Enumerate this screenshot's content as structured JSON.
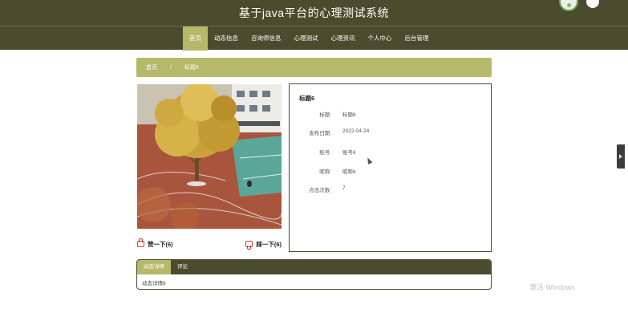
{
  "header": {
    "title": "基于java平台的心理测试系统"
  },
  "nav": {
    "items": [
      {
        "label": "首页",
        "active": true
      },
      {
        "label": "动态信息",
        "active": false
      },
      {
        "label": "咨询师信息",
        "active": false
      },
      {
        "label": "心理测试",
        "active": false
      },
      {
        "label": "心理资讯",
        "active": false
      },
      {
        "label": "个人中心",
        "active": false
      },
      {
        "label": "后台管理",
        "active": false
      }
    ]
  },
  "breadcrumb": {
    "home": "首页",
    "separator": "/",
    "current": "标题6"
  },
  "votes": {
    "like_label": "赞一下(6)",
    "dislike_label": "踩一下(6)"
  },
  "detail": {
    "title": "标题6",
    "rows": [
      {
        "label": "标题:",
        "value": "标题6"
      },
      {
        "label": "发布日期:",
        "value": "2022-04-24"
      },
      {
        "label": "账号:",
        "value": "账号6"
      },
      {
        "label": "昵称:",
        "value": "昵称6"
      },
      {
        "label": "点击次数:",
        "value": "7"
      }
    ]
  },
  "tabs": {
    "items": [
      {
        "label": "动态详情",
        "active": true
      },
      {
        "label": "评论",
        "active": false
      }
    ],
    "content": "动态详情6"
  },
  "watermark": "激活 Windows",
  "colors": {
    "primary_dark": "#4b4b2e",
    "accent": "#b6b86a",
    "vote_icon": "#d23a2f"
  }
}
